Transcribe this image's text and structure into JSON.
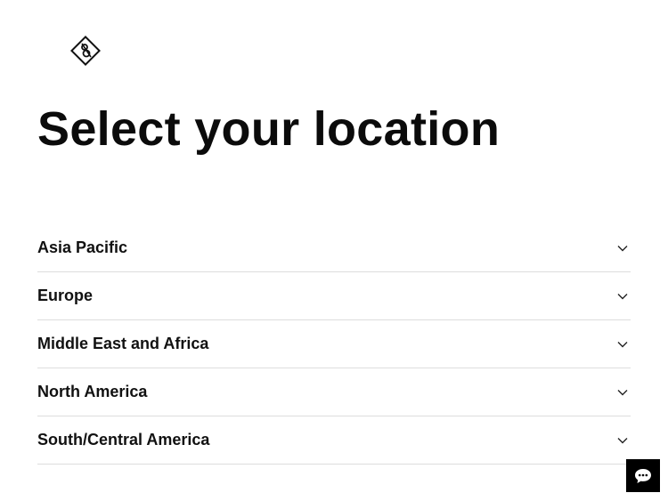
{
  "page": {
    "title": "Select your location"
  },
  "regions": [
    {
      "label": "Asia Pacific"
    },
    {
      "label": "Europe"
    },
    {
      "label": "Middle East and Africa"
    },
    {
      "label": "North America"
    },
    {
      "label": "South/Central America"
    }
  ],
  "icons": {
    "logo": "diamond-logo-icon",
    "expand": "chevron-down-icon",
    "chat": "chat-bubble-icon"
  },
  "colors": {
    "text": "#111111",
    "divider": "#dddddd",
    "chat_background": "#000000"
  }
}
